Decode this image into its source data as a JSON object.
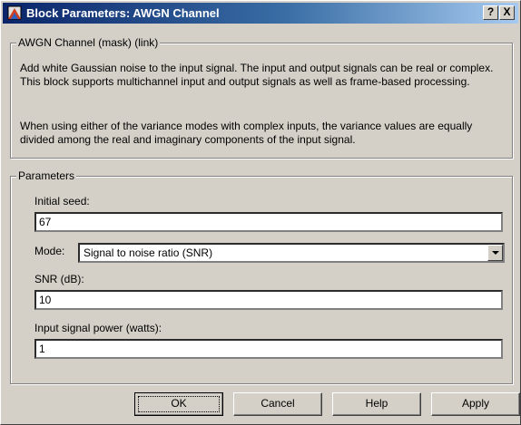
{
  "window": {
    "title": "Block Parameters: AWGN Channel",
    "help_button": "?",
    "close_button": "X"
  },
  "description": {
    "group_title": "AWGN Channel (mask) (link)",
    "paragraph1": "Add white Gaussian noise to the input signal. The input and output signals can be real or complex. This block supports multichannel input and output signals as well as frame-based processing.",
    "paragraph2": "When using either of the variance modes with complex inputs, the variance values are equally divided among the real and imaginary components of the input signal."
  },
  "parameters": {
    "group_title": "Parameters",
    "initial_seed_label": "Initial seed:",
    "initial_seed_value": "67",
    "mode_label": "Mode:",
    "mode_value": "Signal to noise ratio  (SNR)",
    "snr_label": "SNR (dB):",
    "snr_value": "10",
    "power_label": "Input signal power (watts):",
    "power_value": "1"
  },
  "buttons": {
    "ok": "OK",
    "cancel": "Cancel",
    "help": "Help",
    "apply": "Apply"
  }
}
